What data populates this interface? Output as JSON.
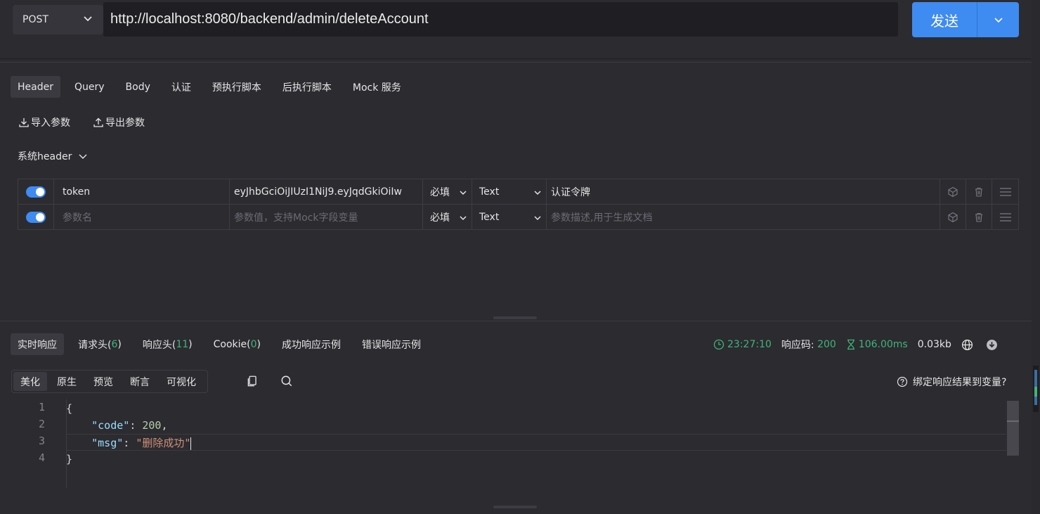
{
  "request": {
    "method": "POST",
    "url": "http://localhost:8080/backend/admin/deleteAccount",
    "send_label": "发送"
  },
  "tabs": [
    {
      "label": "Header",
      "active": true
    },
    {
      "label": "Query"
    },
    {
      "label": "Body"
    },
    {
      "label": "认证"
    },
    {
      "label": "预执行脚本"
    },
    {
      "label": "后执行脚本"
    },
    {
      "label": "Mock 服务"
    }
  ],
  "tools": {
    "import_label": "导入参数",
    "export_label": "导出参数"
  },
  "system_header_label": "系统header",
  "params": {
    "rows": [
      {
        "enabled": true,
        "name": "token",
        "value": "eyJhbGciOiJIUzI1NiJ9.eyJqdGkiOiIw",
        "required": "必填",
        "type": "Text",
        "description": "认证令牌"
      },
      {
        "enabled": true,
        "name": "",
        "value": "",
        "required": "必填",
        "type": "Text",
        "description": ""
      }
    ],
    "placeholders": {
      "name": "参数名",
      "value": "参数值，支持Mock字段变量",
      "description": "参数描述,用于生成文档"
    }
  },
  "response": {
    "tabs": [
      {
        "label": "实时响应",
        "active": true
      },
      {
        "label": "请求头(",
        "count": "6",
        "close": ")"
      },
      {
        "label": "响应头(",
        "count": "11",
        "close": ")"
      },
      {
        "label": "Cookie(",
        "count": "0",
        "close": ")"
      },
      {
        "label": "成功响应示例"
      },
      {
        "label": "错误响应示例"
      }
    ],
    "time": "23:27:10",
    "status_label": "响应码:",
    "status_code": "200",
    "duration": "106.00ms",
    "size": "0.03kb",
    "view_tabs": [
      {
        "label": "美化",
        "active": true
      },
      {
        "label": "原生"
      },
      {
        "label": "预览"
      },
      {
        "label": "断言"
      },
      {
        "label": "可视化"
      }
    ],
    "bind_label": "绑定响应结果到变量?",
    "body_lines": [
      {
        "no": "1",
        "open": "{"
      },
      {
        "no": "2",
        "key": "\"code\"",
        "sep": ": ",
        "num": "200",
        "tail": ","
      },
      {
        "no": "3",
        "key": "\"msg\"",
        "sep": ": ",
        "str": "\"删除成功\""
      },
      {
        "no": "4",
        "open": "}"
      }
    ]
  },
  "colors": {
    "accent": "#3e8bf2",
    "success": "#3fb57a",
    "background": "#2b2b30"
  }
}
